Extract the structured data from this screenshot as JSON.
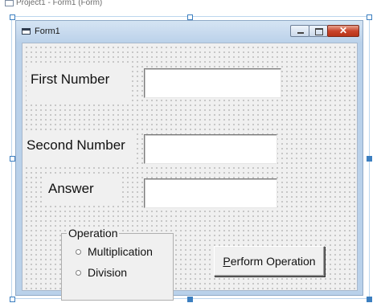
{
  "designer": {
    "title": "Project1 - Form1 (Form)"
  },
  "window": {
    "title": "Form1",
    "close_glyph": "✕"
  },
  "labels": {
    "first_number": "First Number",
    "second_number": "Second Number",
    "answer": "Answer"
  },
  "textboxes": {
    "first_number": "",
    "second_number": "",
    "answer": ""
  },
  "operation_frame": {
    "legend": "Operation",
    "options": [
      "Multiplication",
      "Division"
    ]
  },
  "button": {
    "accelerator": "P",
    "label_rest": "erform Operation"
  }
}
